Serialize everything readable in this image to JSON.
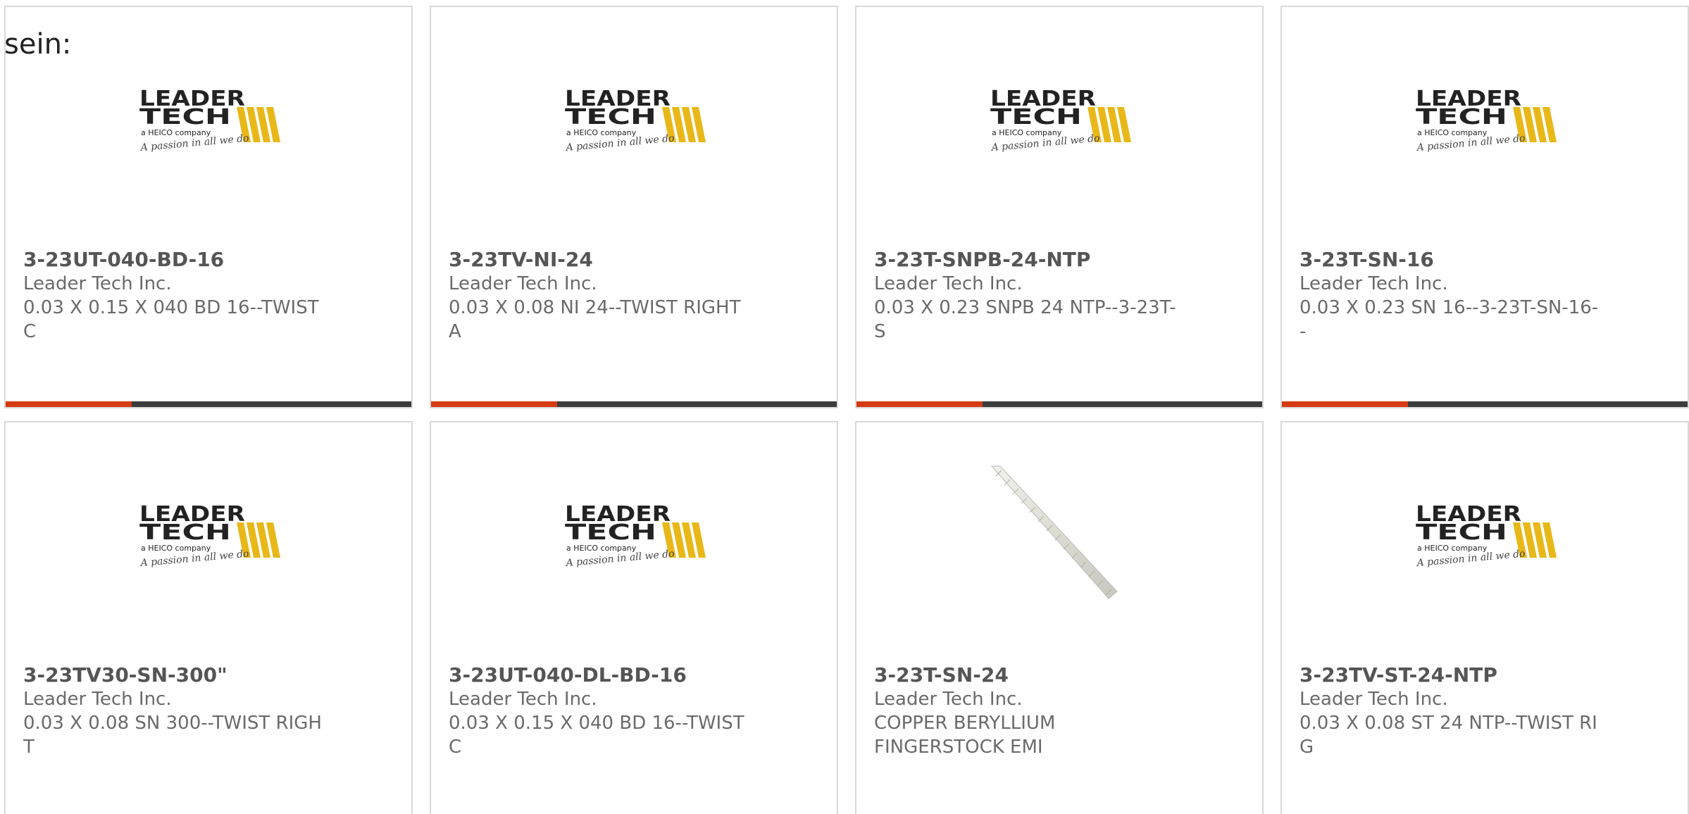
{
  "intro_text": "sein:",
  "colors": {
    "accent": "#d63a13",
    "bar_track": "#3b3b3b",
    "logo_yellow": "#e8b818",
    "text": "#6a6a6a"
  },
  "logo": {
    "line1": "LEADER",
    "line2": "TECH",
    "line3": "a HEICO company",
    "tagline": "A passion in all we do"
  },
  "cards": [
    {
      "part": "3-23UT-040-BD-16",
      "manufacturer": "Leader Tech Inc.",
      "description": "0.03 X 0.15 X 040 BD 16--TWIST C",
      "image": "leader-tech-logo",
      "progress": 0.31
    },
    {
      "part": "3-23TV-NI-24",
      "manufacturer": "Leader Tech Inc.",
      "description": "0.03 X 0.08 NI 24--TWIST RIGHT A",
      "image": "leader-tech-logo",
      "progress": 0.31
    },
    {
      "part": "3-23T-SNPB-24-NTP",
      "manufacturer": "Leader Tech Inc.",
      "description": "0.03 X 0.23 SNPB 24 NTP--3-23T-S",
      "image": "leader-tech-logo",
      "progress": 0.31
    },
    {
      "part": "3-23T-SN-16",
      "manufacturer": "Leader Tech Inc.",
      "description": "0.03 X 0.23 SN 16--3-23T-SN-16--",
      "image": "leader-tech-logo",
      "progress": 0.31
    },
    {
      "part": "3-23TV30-SN-300\"",
      "manufacturer": "Leader Tech Inc.",
      "description": "0.03 X 0.08 SN 300--TWIST RIGHT",
      "image": "leader-tech-logo"
    },
    {
      "part": "3-23UT-040-DL-BD-16",
      "manufacturer": "Leader Tech Inc.",
      "description": "0.03 X 0.15 X 040 BD 16--TWIST C",
      "image": "leader-tech-logo"
    },
    {
      "part": "3-23T-SN-24",
      "manufacturer": "Leader Tech Inc.",
      "description": "COPPER BERYLLIUM FINGERSTOCK EMI",
      "image": "fingerstock-photo"
    },
    {
      "part": "3-23TV-ST-24-NTP",
      "manufacturer": "Leader Tech Inc.",
      "description": "0.03 X 0.08 ST 24 NTP--TWIST RIG",
      "image": "leader-tech-logo"
    }
  ]
}
